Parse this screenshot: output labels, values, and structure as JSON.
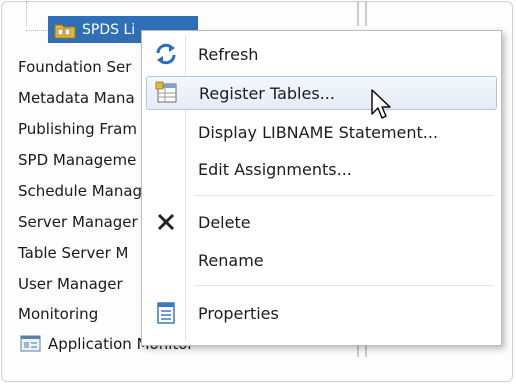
{
  "tree": {
    "selected_node": "SPDS Li",
    "items": [
      "Foundation Ser",
      "Metadata Mana",
      "Publishing Fram",
      "SPD Manageme",
      "Schedule Manag",
      "Server Manager",
      "Table Server M",
      "User Manager",
      "Monitoring"
    ],
    "app_monitor": "Application Monitor"
  },
  "context_menu": {
    "items": [
      {
        "label": "Refresh",
        "icon": "refresh-icon"
      },
      {
        "label": "Register Tables...",
        "icon": "register-tables-icon"
      },
      {
        "label": "Display LIBNAME Statement...",
        "icon": ""
      },
      {
        "label": "Edit Assignments...",
        "icon": ""
      },
      {
        "label": "Delete",
        "icon": "delete-x-icon"
      },
      {
        "label": "Rename",
        "icon": ""
      },
      {
        "label": "Properties",
        "icon": "properties-icon"
      }
    ],
    "hovered_item": "Register Tables..."
  },
  "colors": {
    "selection": "#2f6fb8",
    "menu_hover": "#e3ecf8",
    "refresh_icon": "#2a6cc4",
    "properties_icon": "#3a78c8"
  }
}
